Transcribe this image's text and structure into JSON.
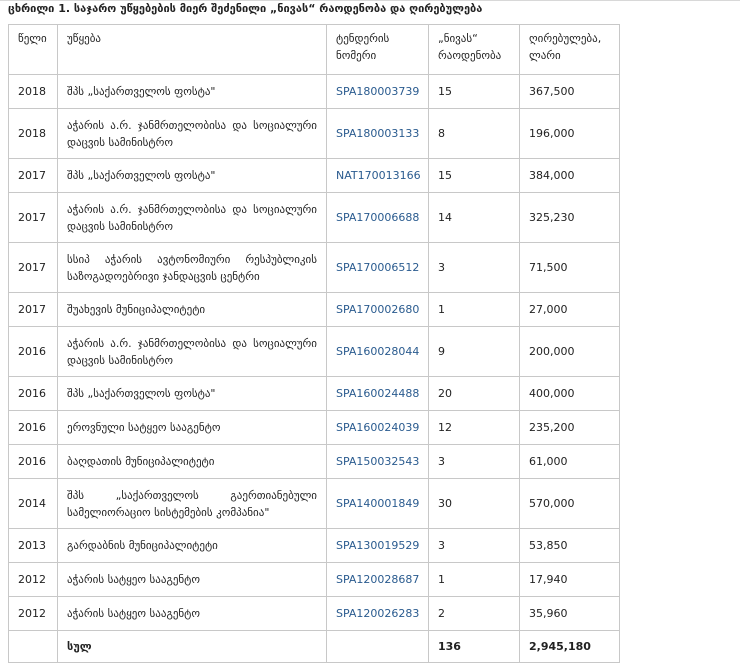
{
  "caption": "ცხრილი 1. საჯარო უწყებების მიერ შეძენილი „ნივას“ რაოდენობა და ღირებულება",
  "table": {
    "headers": {
      "year": "წელი",
      "org": "უწყება",
      "tender_l1": "ტენდერის",
      "tender_l2": "ნომერი",
      "count_l1": "„ნივას“",
      "count_l2": "რაოდენობა",
      "value_l1": "ღირებულება,",
      "value_l2": "ლარი"
    },
    "rows": [
      {
        "year": "2018",
        "org": "შპს „საქართველოს ფოსტა\"",
        "tender": "SPA180003739",
        "count": "15",
        "value": "367,500"
      },
      {
        "year": "2018",
        "org": "აჭარის ა.რ. ჯანმრთელობისა და სოციალური დაცვის სამინისტრო",
        "tender": "SPA180003133",
        "count": "8",
        "value": "196,000"
      },
      {
        "year": "2017",
        "org": "შპს „საქართველოს ფოსტა\"",
        "tender": "NAT170013166",
        "count": "15",
        "value": "384,000"
      },
      {
        "year": "2017",
        "org": "აჭარის ა.რ. ჯანმრთელობისა და სოციალური დაცვის სამინისტრო",
        "tender": "SPA170006688",
        "count": "14",
        "value": "325,230"
      },
      {
        "year": "2017",
        "org": "სსიპ აჭარის ავტონომიური რესპუბლიკის საზოგადოებრივი ჯანდაცვის ცენტრი",
        "tender": "SPA170006512",
        "count": "3",
        "value": "71,500"
      },
      {
        "year": "2017",
        "org": "შუახევის მუნიციპალიტეტი",
        "tender": "SPA170002680",
        "count": "1",
        "value": "27,000"
      },
      {
        "year": "2016",
        "org": "აჭარის ა.რ. ჯანმრთელობისა და სოციალური დაცვის სამინისტრო",
        "tender": "SPA160028044",
        "count": "9",
        "value": "200,000"
      },
      {
        "year": "2016",
        "org": "შპს „საქართველოს ფოსტა\"",
        "tender": "SPA160024488",
        "count": "20",
        "value": "400,000"
      },
      {
        "year": "2016",
        "org": "ეროვნული სატყეო სააგენტო",
        "tender": "SPA160024039",
        "count": "12",
        "value": "235,200"
      },
      {
        "year": "2016",
        "org": "ბაღდათის მუნიციპალიტეტი",
        "tender": "SPA150032543",
        "count": "3",
        "value": "61,000"
      },
      {
        "year": "2014",
        "org": "შპს „საქართველოს გაერთიანებული სამელიორაციო სისტემების კომპანია\"",
        "tender": "SPA140001849",
        "count": "30",
        "value": "570,000"
      },
      {
        "year": "2013",
        "org": "გარდაბნის მუნიციპალიტეტი",
        "tender": "SPA130019529",
        "count": "3",
        "value": "53,850"
      },
      {
        "year": "2012",
        "org": "აჭარის სატყეო სააგენტო",
        "tender": "SPA120028687",
        "count": "1",
        "value": "17,940"
      },
      {
        "year": "2012",
        "org": "აჭარის სატყეო სააგენტო",
        "tender": "SPA120026283",
        "count": "2",
        "value": "35,960"
      }
    ],
    "total": {
      "label": "სულ",
      "count": "136",
      "value": "2,945,180"
    }
  }
}
